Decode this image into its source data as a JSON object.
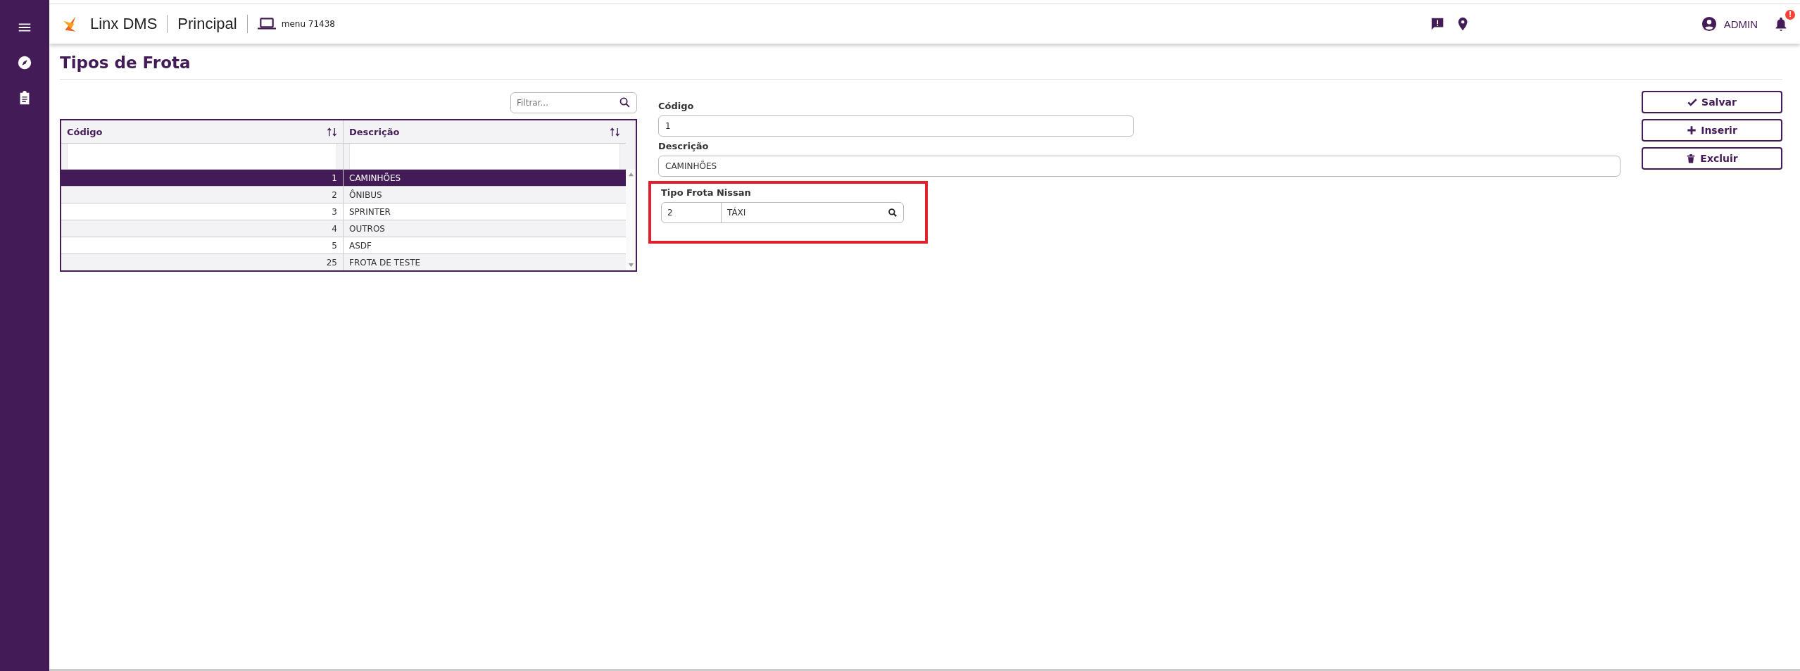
{
  "topbar": {
    "brand": "Linx DMS",
    "module": "Principal",
    "menu_label": "menu 71438",
    "user": "ADMIN",
    "notification_badge": "!"
  },
  "page": {
    "title": "Tipos de Frota"
  },
  "grid": {
    "filter": {
      "placeholder": "Filtrar..."
    },
    "columns": [
      "Código",
      "Descrição"
    ],
    "rows": [
      {
        "code": "1",
        "description": "CAMINHÕES",
        "selected": true
      },
      {
        "code": "2",
        "description": "ÔNIBUS",
        "selected": false
      },
      {
        "code": "3",
        "description": "SPRINTER",
        "selected": false
      },
      {
        "code": "4",
        "description": "OUTROS",
        "selected": false
      },
      {
        "code": "5",
        "description": "ASDF",
        "selected": false
      },
      {
        "code": "25",
        "description": "FROTA DE TESTE",
        "selected": false
      }
    ]
  },
  "form": {
    "fields": [
      {
        "kind": "short_text",
        "label": "Código",
        "value": "1"
      },
      {
        "kind": "wide_text",
        "label": "Descrição",
        "value": "CAMINHÕES"
      },
      {
        "kind": "lookup",
        "label": "Tipo Frota Nissan",
        "code": "2",
        "value": "TÁXI",
        "highlighted": true
      }
    ]
  },
  "actions": [
    {
      "kind": "save",
      "label": "Salvar"
    },
    {
      "kind": "insert",
      "label": "Inserir"
    },
    {
      "kind": "delete",
      "label": "Excluir"
    }
  ]
}
